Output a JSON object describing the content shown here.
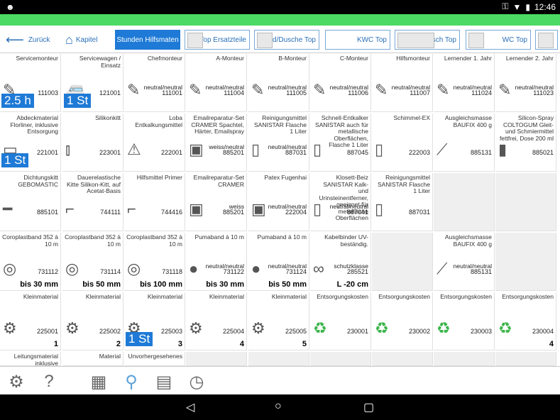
{
  "status": {
    "time": "12:46"
  },
  "nav": {
    "back": "Zurück",
    "chapter": "Kapitel",
    "tabs": [
      "Stunden Hilfsmaten",
      "Top Ersatzteile",
      "Bad/Dusche Top",
      "KWC Top",
      "Waschtisch Top",
      "WC Top"
    ]
  },
  "grid": {
    "rows": [
      [
        {
          "t": "Servicemonteur",
          "code": "111003",
          "badge": "2.5 h",
          "icon": "hand-tools-icon"
        },
        {
          "t": "Servicewagen / Einsatz",
          "code": "121001",
          "badge": "1 St",
          "icon": "service-van-icon"
        },
        {
          "t": "Chefmonteur",
          "sub": "neutral/neutral",
          "code": "111001",
          "icon": "hand-tools-icon"
        },
        {
          "t": "A-Monteur",
          "sub": "neutral/neutral",
          "code": "111004",
          "icon": "hand-tools-icon"
        },
        {
          "t": "B-Monteur",
          "sub": "neutral/neutral",
          "code": "111005",
          "icon": "hand-tools-icon"
        },
        {
          "t": "C-Monteur",
          "sub": "neutral/neutral",
          "code": "111006",
          "icon": "hand-tools-icon"
        },
        {
          "t": "Hilfsmonteur",
          "sub": "neutral/neutral",
          "code": "111007",
          "icon": "hand-tools-icon"
        },
        {
          "t": "Lernender 1. Jahr",
          "sub": "neutral/neutral",
          "code": "111024",
          "icon": "hand-tools-icon"
        },
        {
          "t": "Lernender 2. Jahr",
          "sub": "neutral/neutral",
          "code": "111023",
          "icon": "hand-tools-icon"
        }
      ],
      [
        {
          "t": "Abdeckmaterial Florliner, inklusive Entsorgung",
          "code": "221001",
          "badge": "1 St",
          "icon": "roll-icon"
        },
        {
          "t": "Silikonkitt",
          "code": "223001",
          "icon": "tube-icon"
        },
        {
          "t": "Loba Entkalkungsmittel",
          "code": "222001",
          "icon": "hazard-icon"
        },
        {
          "t": "Emailreparatur-Set CRAMER Spachtel, Härter, Emailspray",
          "sub": "weiss/neutral",
          "code": "885201",
          "icon": "kit-icon"
        },
        {
          "t": "Reinigungsmittel SANISTAR Flasche 1 Liter",
          "sub": "neutral/neutral",
          "code": "887031",
          "icon": "bottle-icon"
        },
        {
          "t": "Schnell-Entkalker SANISTAR auch für metallische Oberflächen, Flasche 1 Liter",
          "code": "887045",
          "icon": "bottle-icon"
        },
        {
          "t": "Schimmel-EX",
          "code": "222003",
          "icon": "spray-icon"
        },
        {
          "t": "Ausgleichsmasse BAUFIX 400 g",
          "code": "885131",
          "icon": "spatula-icon"
        },
        {
          "t": "Silicon-Spray COLTOGUM Gleit- und Schmiermittel fettfrei, Dose 200 ml",
          "code": "885021",
          "icon": "spray-can-icon"
        }
      ],
      [
        {
          "t": "Dichtungskitt GEBOMASTIC",
          "code": "885101",
          "icon": "strip-icon"
        },
        {
          "t": "Dauerelastische Kitte Silikon-Kitt, auf Acetat-Basis",
          "code": "744111",
          "icon": "caulk-gun-icon"
        },
        {
          "t": "Hilfsmittel Primer",
          "code": "744416",
          "icon": "caulk-gun-icon"
        },
        {
          "t": "Emailreparatur-Set CRAMER",
          "sub": "weiss",
          "code": "885201",
          "icon": "kit-icon"
        },
        {
          "t": "Patex Fugenhai",
          "sub": "neutral/neutral",
          "code": "222004",
          "icon": "package-icon"
        },
        {
          "t": "Klosett-Beiz SANISTAR Kalk- und Urinsteinentferner, geeignet für metallische Oberflächen",
          "sub": "neutral/neutral",
          "code": "887041",
          "icon": "bottle-icon"
        },
        {
          "t": "Reinigungsmittel SANISTAR Flasche 1 Liter",
          "code": "887031",
          "icon": "bottle-icon"
        },
        {
          "empty": true
        },
        {
          "empty": true
        }
      ],
      [
        {
          "t": "Coroplastband 352 à 10 m",
          "code": "731112",
          "big": "bis 30 mm",
          "icon": "tape-roll-icon"
        },
        {
          "t": "Coroplastband 352 à 10 m",
          "code": "731114",
          "big": "bis 50 mm",
          "icon": "tape-roll-icon"
        },
        {
          "t": "Coroplastband 352 à 10 m",
          "code": "731118",
          "big": "bis 100 mm",
          "icon": "tape-roll-icon"
        },
        {
          "t": "Pumaband à 10 m",
          "sub": "neutral/neutral",
          "code": "731122",
          "big": "bis 30 mm",
          "icon": "black-tape-icon"
        },
        {
          "t": "Pumaband à 10 m",
          "sub": "neutral/neutral",
          "code": "731124",
          "big": "bis 50 mm",
          "icon": "black-tape-icon"
        },
        {
          "t": "Kabelbinder UV-beständig.",
          "sub": "schutzklasse",
          "code": "285521",
          "big": "L -20 cm",
          "icon": "cable-tie-icon"
        },
        {
          "empty": true
        },
        {
          "t": "Ausgleichsmasse BAUFIX 400 g",
          "sub": "neutral/neutral",
          "code": "885131",
          "icon": "spatula-icon"
        },
        {
          "empty": true
        }
      ],
      [
        {
          "t": "Kleinmaterial",
          "code": "225001",
          "big": "1",
          "icon": "screws-icon"
        },
        {
          "t": "Kleinmaterial",
          "code": "225002",
          "big": "2",
          "icon": "screws-icon"
        },
        {
          "t": "Kleinmaterial",
          "code": "225003",
          "big": "3",
          "badge": "1 St",
          "icon": "screws-icon"
        },
        {
          "t": "Kleinmaterial",
          "code": "225004",
          "big": "4",
          "icon": "screws-icon"
        },
        {
          "t": "Kleinmaterial",
          "code": "225005",
          "big": "5",
          "icon": "screws-icon"
        },
        {
          "t": "Entsorgungskosten",
          "code": "230001",
          "icon": "recycle-icon"
        },
        {
          "t": "Entsorgungskosten",
          "code": "230002",
          "icon": "recycle-icon"
        },
        {
          "t": "Entsorgungskosten",
          "code": "230003",
          "icon": "recycle-icon"
        },
        {
          "t": "Entsorgungskosten",
          "code": "230004",
          "big": "4",
          "icon": "recycle-icon"
        }
      ],
      [
        {
          "t": "Leitungsmaterial inklusive",
          "partial": true
        },
        {
          "t": "Material",
          "partial": true
        },
        {
          "t": "Unvorhergesehenes",
          "partial": true
        },
        {
          "partial": true,
          "empty": true
        },
        {
          "partial": true,
          "empty": true
        },
        {
          "partial": true,
          "empty": true
        },
        {
          "partial": true,
          "empty": true
        },
        {
          "partial": true,
          "empty": true
        },
        {
          "partial": true,
          "empty": true
        }
      ]
    ]
  },
  "bottom": {
    "icons": [
      "gear-icon",
      "help-icon",
      "calculator-icon",
      "screw-icon",
      "clipboard-icon",
      "clock-icon"
    ]
  }
}
